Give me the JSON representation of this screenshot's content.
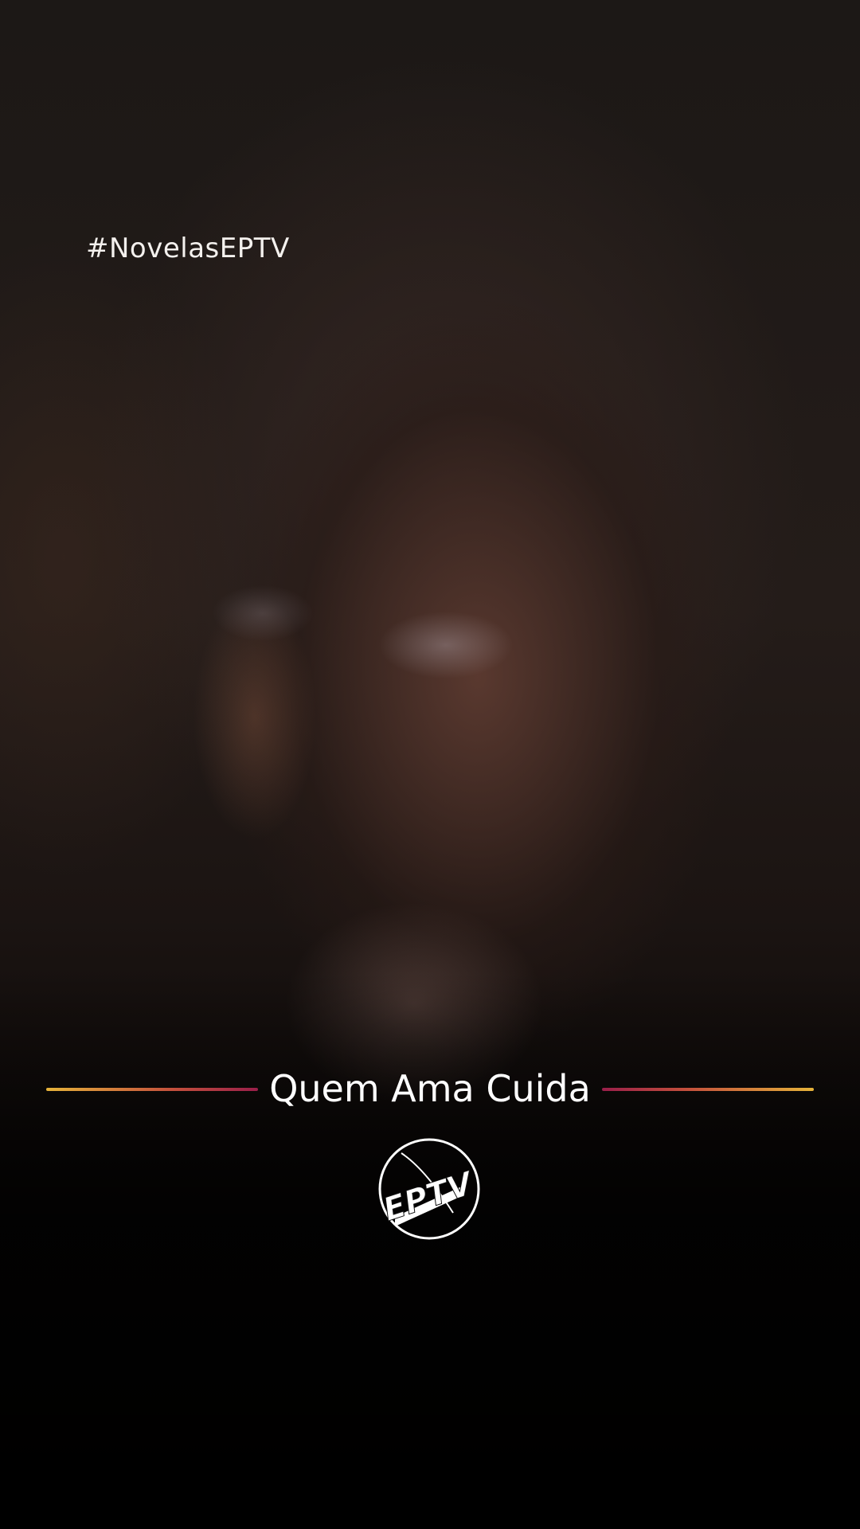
{
  "overlay": {
    "hashtag": "#NovelasEPTV",
    "title": "Quem Ama Cuida"
  },
  "logo": {
    "text": "EPTV",
    "icon": "eptv-logo-icon"
  },
  "colors": {
    "line_gold": "#e6b33a",
    "line_magenta": "#9a1f4a",
    "text": "#ffffff"
  }
}
